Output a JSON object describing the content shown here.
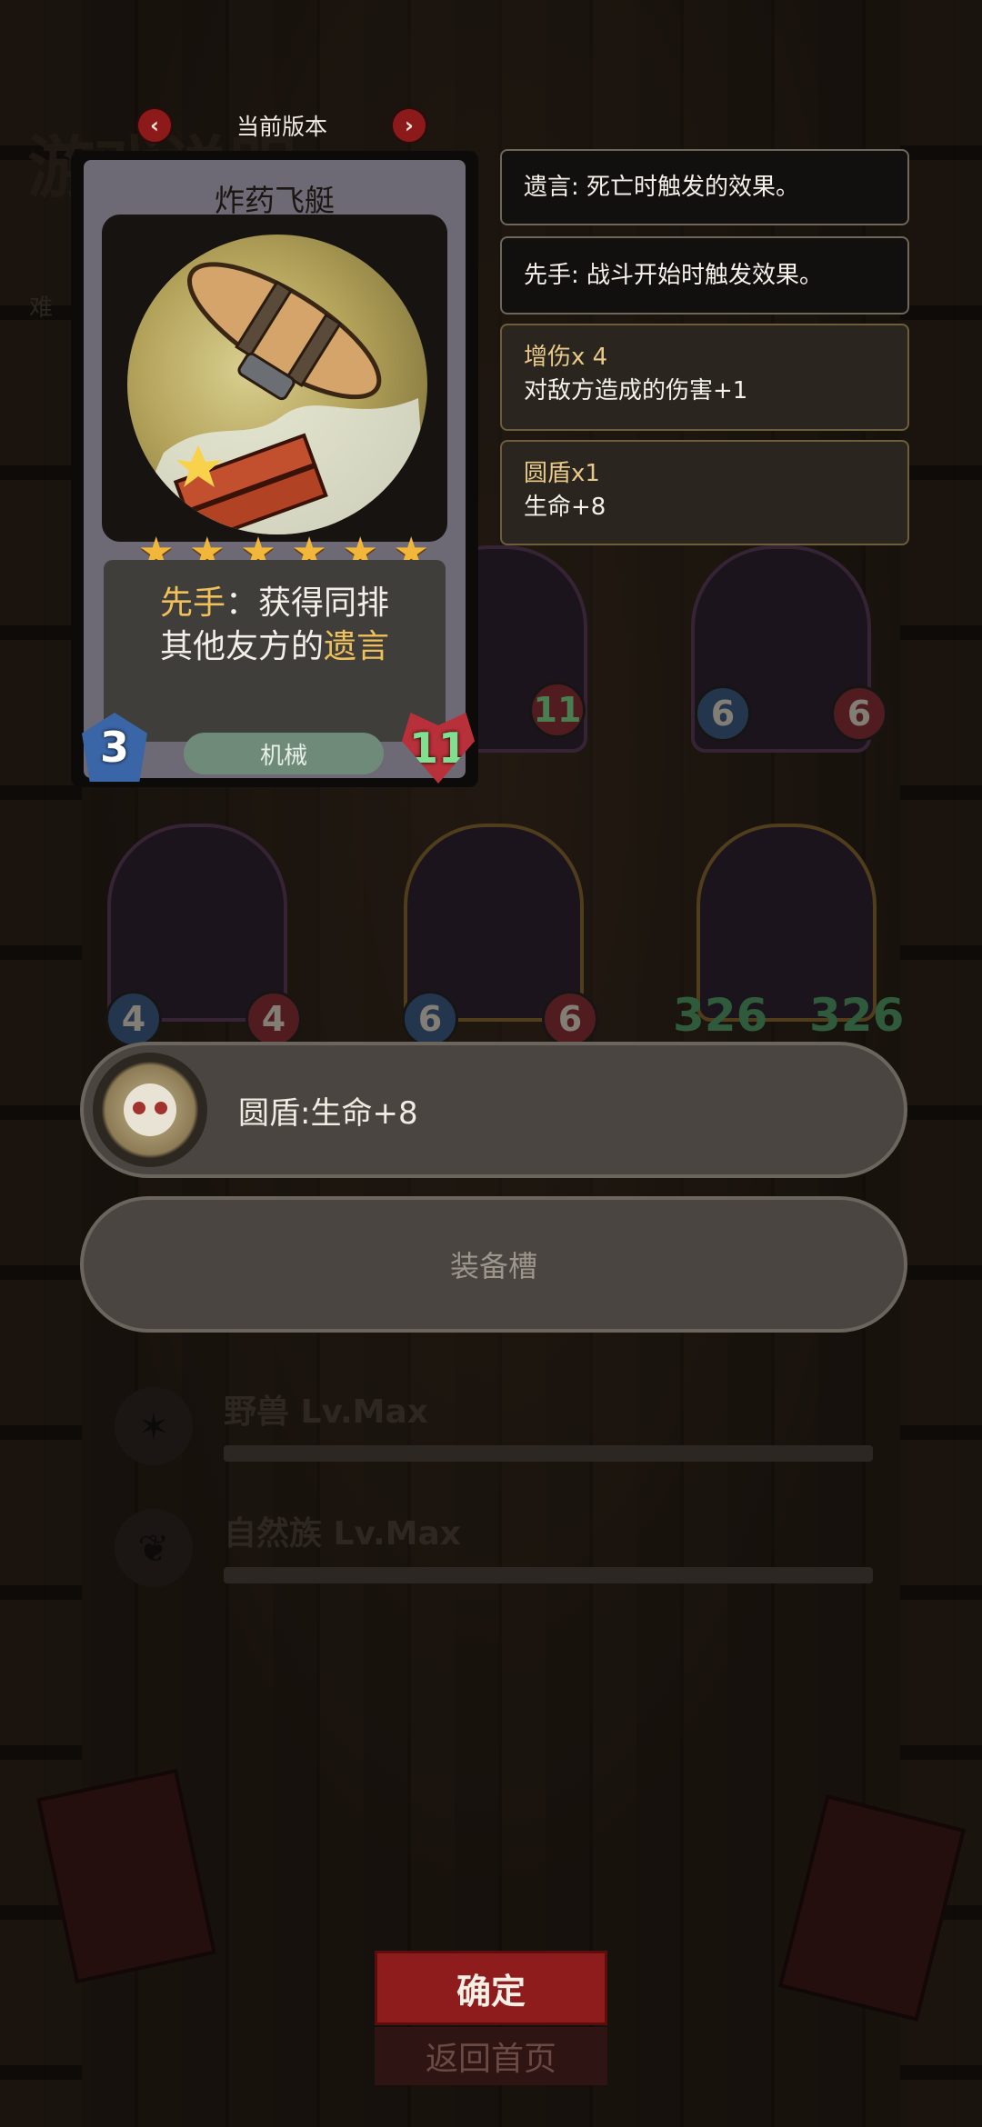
{
  "header": {
    "ghost_title": "游戏说明",
    "ghost_difficulty": "难",
    "version_label": "当前版本",
    "prev_icon": "chevron-left-icon",
    "next_icon": "chevron-right-icon"
  },
  "card": {
    "name": "炸药飞艇",
    "stars": 6,
    "ability_keyword_1": "先手",
    "ability_text_1": "：获得同排",
    "ability_text_2": "其他友方的",
    "ability_keyword_2": "遗言",
    "cost": "3",
    "tribe": "机械",
    "health": "11"
  },
  "tooltips": [
    {
      "text": "遗言: 死亡时触发的效果。"
    },
    {
      "text": "先手: 战斗开始时触发效果。"
    },
    {
      "title": "增伤x 4",
      "text": "对敌方造成的伤害+1"
    },
    {
      "title": "圆盾x1",
      "text": "生命+8"
    }
  ],
  "board": {
    "slot_a": {
      "health": "11"
    },
    "slot_b": {
      "attack": "6",
      "health": "6"
    },
    "slot_c": {
      "attack": "4",
      "health": "4"
    },
    "slot_d": {
      "attack": "6",
      "health": "6"
    },
    "slot_e": {
      "attack": "326",
      "health": "326"
    }
  },
  "equipment": {
    "item_text": "圆盾:生命+8",
    "empty_label": "装备槽"
  },
  "synergies": [
    {
      "name": "野兽 Lv.Max"
    },
    {
      "name": "自然族 Lv.Max"
    }
  ],
  "buttons": {
    "confirm": "确定",
    "back_home": "返回首页"
  },
  "colors": {
    "accent_red": "#8e1c1c",
    "keyword_gold": "#f0c05a",
    "cost_blue": "#3a66a8",
    "health_red": "#b8303a"
  }
}
